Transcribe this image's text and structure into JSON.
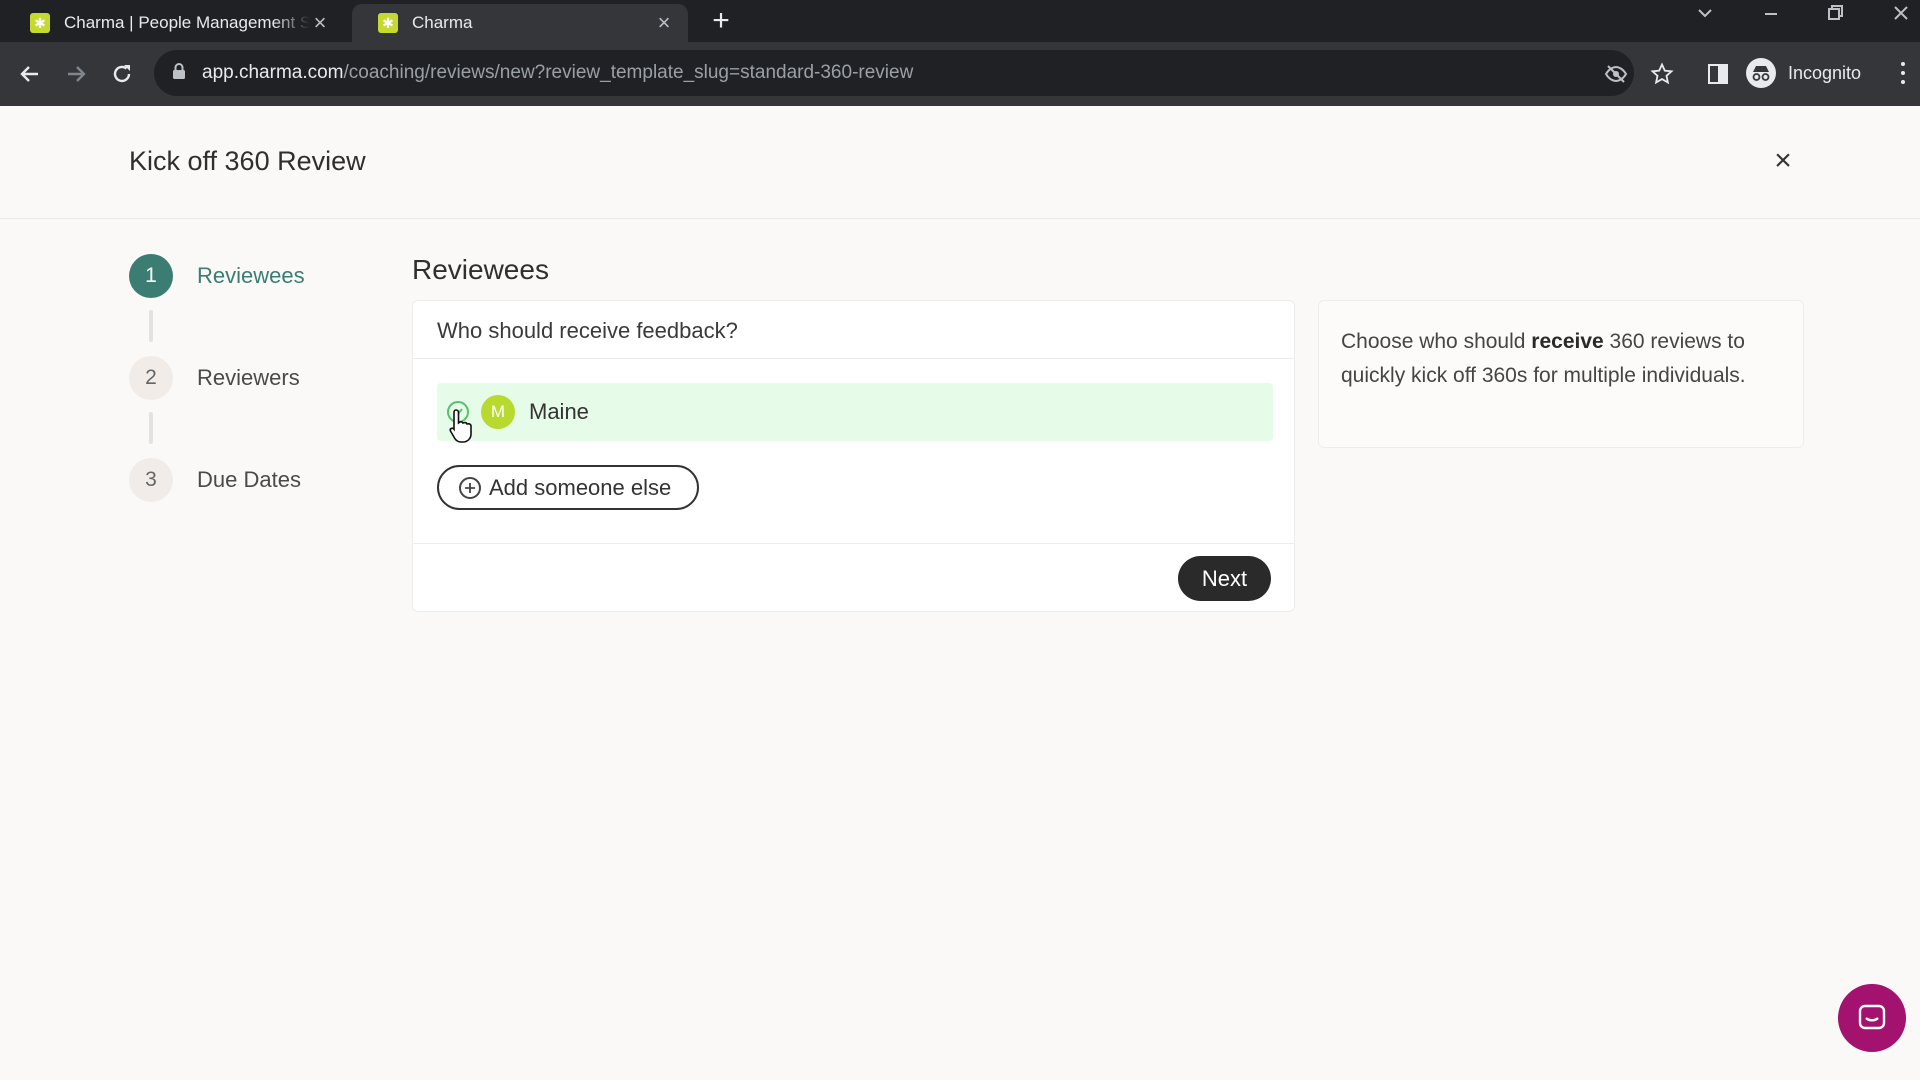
{
  "browser": {
    "tabs": [
      {
        "title": "Charma | People Management S",
        "active": false
      },
      {
        "title": "Charma",
        "active": true
      }
    ],
    "url_host": "app.charma.com",
    "url_path": "/coaching/reviews/new?review_template_slug=standard-360-review",
    "profile_label": "Incognito"
  },
  "page": {
    "title": "Kick off 360 Review",
    "steps": [
      {
        "number": "1",
        "label": "Reviewees",
        "state": "active"
      },
      {
        "number": "2",
        "label": "Reviewers",
        "state": "todo"
      },
      {
        "number": "3",
        "label": "Due Dates",
        "state": "todo"
      }
    ],
    "section_title": "Reviewees",
    "question": "Who should receive feedback?",
    "reviewee": {
      "initial": "M",
      "name": "Maine",
      "selected": true
    },
    "add_button_label": "Add someone else",
    "next_button_label": "Next",
    "info": {
      "before": "Choose who should ",
      "emphasis": "receive",
      "after": " 360 reviews to quickly kick off 360s for multiple individuals."
    }
  },
  "colors": {
    "accent": "#3b7d72",
    "selected_row": "#e6fbe8",
    "avatar": "#b8d92e",
    "chat": "#a3126e",
    "favicon": "#c6d92f"
  }
}
